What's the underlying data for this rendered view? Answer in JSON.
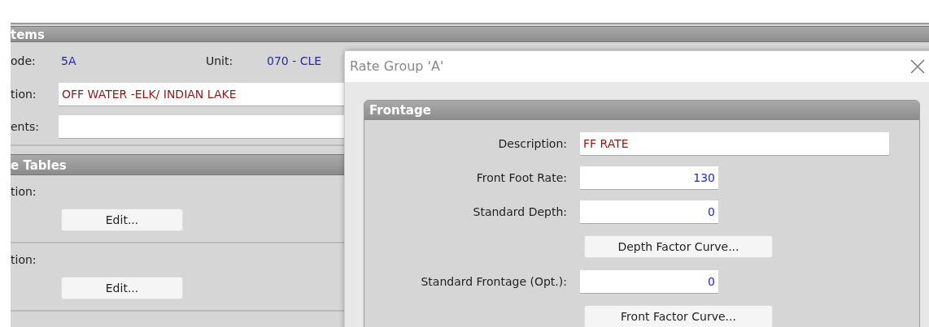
{
  "items_section": {
    "title": "tems",
    "code_label": "ode:",
    "code_value": "5A",
    "unit_label": "Unit:",
    "unit_value": "070 - CLE",
    "description_label": "tion:",
    "description_value": "OFF WATER -ELK/ INDIAN LAKE",
    "comments_label": "ents:"
  },
  "tables_section": {
    "title": "e Tables",
    "rows": [
      {
        "label": "tion:",
        "button": "Edit..."
      },
      {
        "label": "tion:",
        "button": "Edit..."
      }
    ]
  },
  "dialog": {
    "title": "Rate Group 'A'",
    "group": {
      "title": "Frontage",
      "fields": [
        {
          "kind": "text",
          "label": "Description:",
          "value": "FF RATE"
        },
        {
          "kind": "number",
          "label": "Front Foot Rate:",
          "value": "130"
        },
        {
          "kind": "number",
          "label": "Standard Depth:",
          "value": "0"
        },
        {
          "kind": "button",
          "label": "Depth Factor Curve..."
        },
        {
          "kind": "number",
          "label": "Standard Frontage (Opt.):",
          "value": "0"
        },
        {
          "kind": "button",
          "label": "Front Factor Curve..."
        }
      ]
    }
  }
}
